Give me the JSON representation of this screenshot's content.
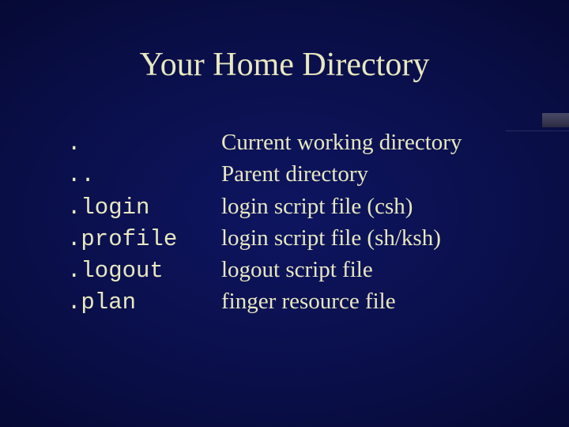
{
  "title": "Your Home Directory",
  "rows": [
    {
      "file": ".",
      "desc": "Current working directory"
    },
    {
      "file": "..",
      "desc": "Parent directory"
    },
    {
      "file": ".login",
      "desc": "login script file (csh)"
    },
    {
      "file": ".profile",
      "desc": "login script file (sh/ksh)"
    },
    {
      "file": ".logout",
      "desc": "logout script file"
    },
    {
      "file": ".plan",
      "desc": "finger resource file"
    }
  ]
}
